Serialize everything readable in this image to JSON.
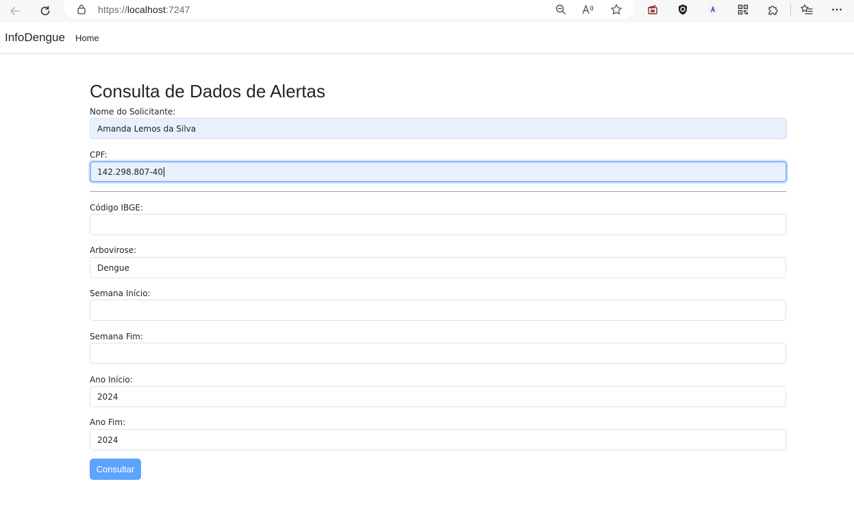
{
  "browser": {
    "url_prefix": "https://",
    "url_host": "localhost",
    "url_port": ":7247",
    "icons": [
      "back-arrow-icon",
      "reload-icon",
      "lock-icon",
      "zoom-out-icon",
      "read-aloud-icon",
      "favorite-star-icon",
      "clapperboard-extension-icon",
      "shield-extension-icon",
      "adblock-extension-icon",
      "qr-code-icon",
      "extensions-puzzle-icon",
      "favorites-list-icon",
      "more-menu-icon"
    ]
  },
  "navbar": {
    "brand": "InfoDengue",
    "home": "Home"
  },
  "page": {
    "title": "Consulta de Dados de Alertas"
  },
  "form": {
    "nome": {
      "label": "Nome do Solicitante:",
      "value": "Amanda Lemos da Silva"
    },
    "cpf": {
      "label": "CPF:",
      "value": "142.298.807-40"
    },
    "codigo_ibge": {
      "label": "Código IBGE:",
      "value": ""
    },
    "arbovirose": {
      "label": "Arbovirose:",
      "value": "Dengue"
    },
    "semana_inicio": {
      "label": "Semana Início:",
      "value": ""
    },
    "semana_fim": {
      "label": "Semana Fim:",
      "value": ""
    },
    "ano_inicio": {
      "label": "Ano Início:",
      "value": "2024"
    },
    "ano_fim": {
      "label": "Ano Fim:",
      "value": "2024"
    },
    "submit": "Consultar"
  },
  "colors": {
    "autofill_bg": "#e8f0fe",
    "focus_border": "#8bb5f5",
    "button_bg": "#5ea4ff",
    "input_border": "#dee2e6"
  }
}
